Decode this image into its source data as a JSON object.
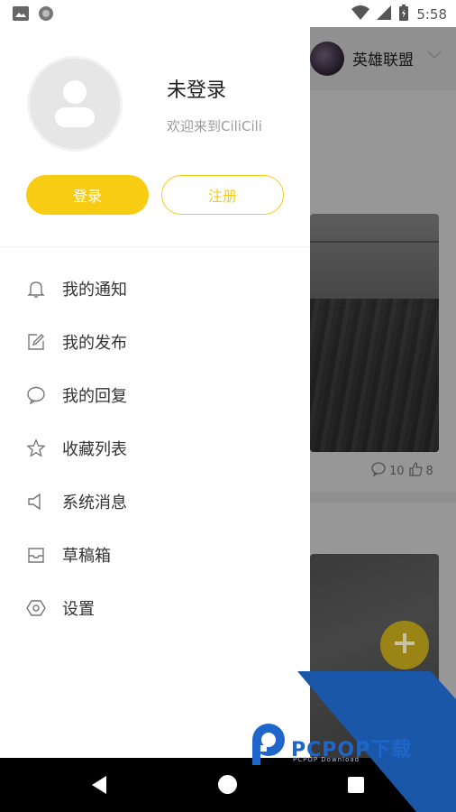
{
  "status_bar": {
    "time": "5:58",
    "left_icons": [
      "image-icon",
      "circle-icon"
    ],
    "right_icons": [
      "wifi-icon",
      "signal-icon",
      "battery-icon"
    ]
  },
  "drawer": {
    "user_name": "未登录",
    "welcome_text": "欢迎来到CiliCili",
    "login_label": "登录",
    "register_label": "注册",
    "menu": [
      {
        "label": "我的通知",
        "icon": "bell-icon"
      },
      {
        "label": "我的发布",
        "icon": "edit-icon"
      },
      {
        "label": "我的回复",
        "icon": "comment-icon"
      },
      {
        "label": "收藏列表",
        "icon": "star-icon"
      },
      {
        "label": "系统消息",
        "icon": "speaker-icon"
      },
      {
        "label": "草稿箱",
        "icon": "inbox-icon"
      },
      {
        "label": "设置",
        "icon": "settings-icon"
      }
    ]
  },
  "background": {
    "game_title": "英雄联盟",
    "comments": "10",
    "likes": "8"
  },
  "watermark": {
    "brand": "PCPOP下载",
    "sub": "PCPOP Download"
  },
  "colors": {
    "accent": "#f8cc12",
    "watermark": "#1e66c9"
  }
}
